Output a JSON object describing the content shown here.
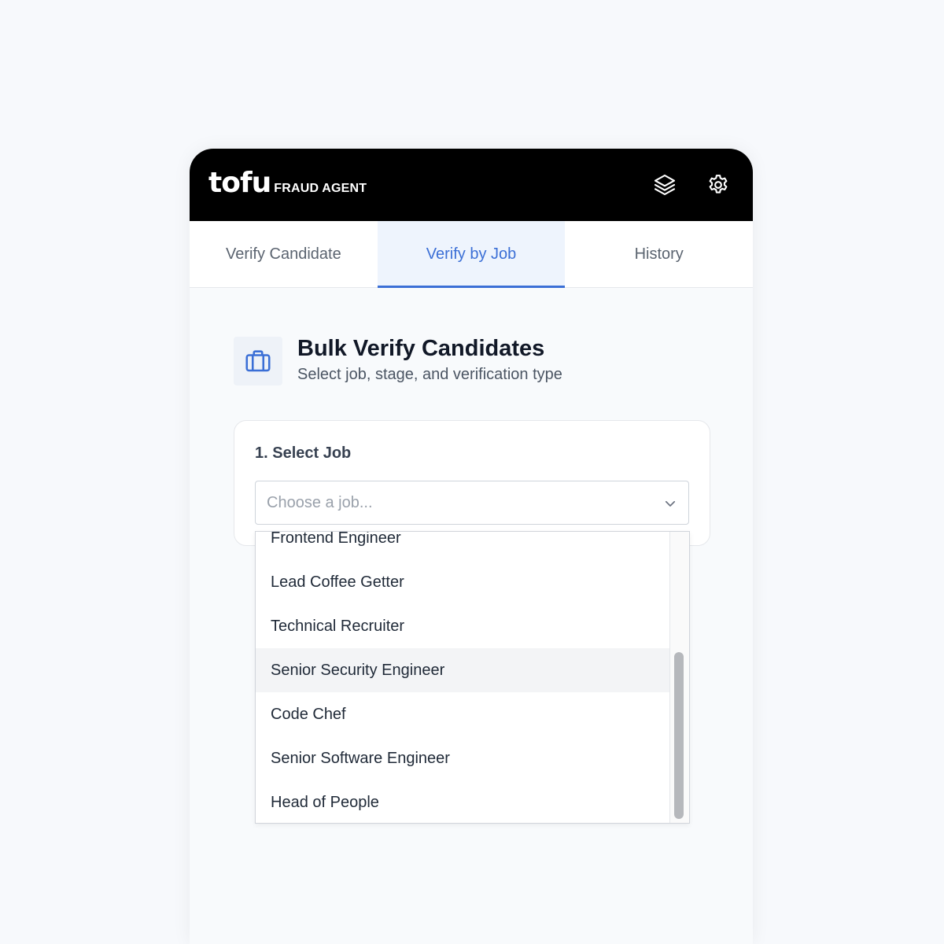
{
  "header": {
    "logo_word": "tofu",
    "logo_sub": "FRAUD AGENT",
    "icons": [
      "layers-icon",
      "gear-icon"
    ]
  },
  "tabs": [
    {
      "label": "Verify Candidate",
      "active": false
    },
    {
      "label": "Verify by Job",
      "active": true
    },
    {
      "label": "History",
      "active": false
    }
  ],
  "section": {
    "icon": "briefcase-icon",
    "title": "Bulk Verify Candidates",
    "subtitle": "Select job, stage, and verification type"
  },
  "job_card": {
    "label": "1. Select Job",
    "placeholder": "Choose a job..."
  },
  "dropdown": {
    "options": [
      "Frontend Engineer",
      "Lead Coffee Getter",
      "Technical Recruiter",
      "Senior Security Engineer",
      "Code Chef",
      "Senior Software Engineer",
      "Head of People"
    ],
    "hovered": "Senior Security Engineer"
  },
  "colors": {
    "accent": "#3b6fd6",
    "header_bg": "#000000",
    "active_tab_bg": "#eef4fd"
  }
}
